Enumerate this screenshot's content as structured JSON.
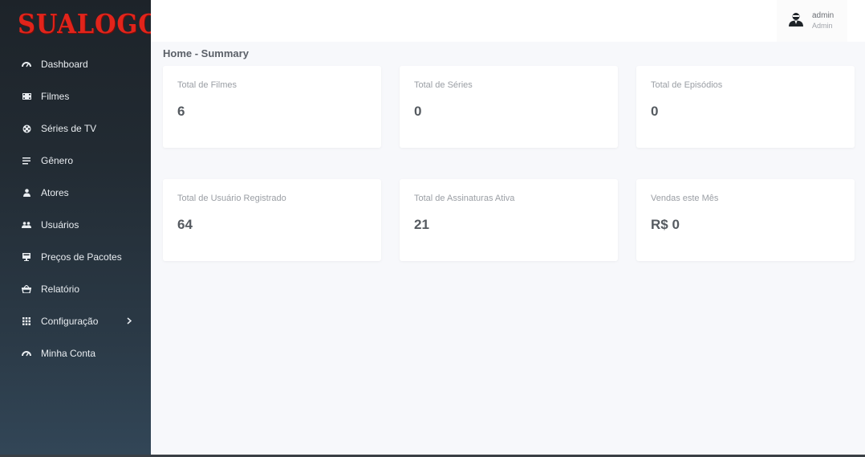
{
  "app": {
    "logo_text": "SUALOGO"
  },
  "sidebar": {
    "items": [
      {
        "label": "Dashboard",
        "icon": "gauge-icon"
      },
      {
        "label": "Filmes",
        "icon": "film-icon"
      },
      {
        "label": "Séries de TV",
        "icon": "reel-icon"
      },
      {
        "label": "Gênero",
        "icon": "list-icon"
      },
      {
        "label": "Atores",
        "icon": "user-icon"
      },
      {
        "label": "Usuários",
        "icon": "users-icon"
      },
      {
        "label": "Preços de Pacotes",
        "icon": "monitor-icon"
      },
      {
        "label": "Relatório",
        "icon": "basket-icon"
      },
      {
        "label": "Configuração",
        "icon": "grid-icon",
        "has_submenu": true
      },
      {
        "label": "Minha Conta",
        "icon": "gauge-icon"
      }
    ]
  },
  "header": {
    "user_name": "admin",
    "user_role": "Admin"
  },
  "breadcrumb": "Home - Summary",
  "cards": [
    {
      "label": "Total de Filmes",
      "value": "6"
    },
    {
      "label": "Total de Séries",
      "value": "0"
    },
    {
      "label": "Total de Episódios",
      "value": "0"
    },
    {
      "label": "Total de Usuário Registrado",
      "value": "64"
    },
    {
      "label": "Total de Assinaturas Ativa",
      "value": "21"
    },
    {
      "label": "Vendas este Mês",
      "value": "R$ 0"
    }
  ],
  "colors": {
    "brand": "#e1241b",
    "sidebar_top": "#1d2329",
    "sidebar_bottom": "#324657",
    "background": "#f7f8fb"
  }
}
